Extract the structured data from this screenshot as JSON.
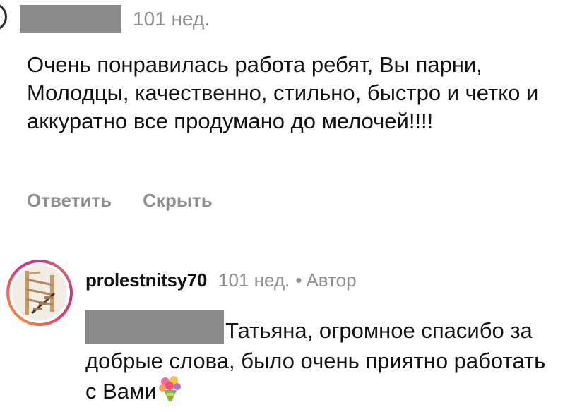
{
  "comment": {
    "time": "101 нед.",
    "text": "Очень понравилась работа ребят, Вы парни, Молодцы, качественно, стильно, быстро и четко и аккуратно все продумано до мелочей!!!!",
    "reply_label": "Ответить",
    "hide_label": "Скрыть"
  },
  "reply": {
    "username": "prolestnitsy70",
    "time": "101 нед.",
    "separator": "•",
    "author_badge": "Автор",
    "text": "Татьяна, огромное спасибо за добрые слова, было очень приятно работать с Вами",
    "emoji": "bouquet-emoji"
  },
  "colors": {
    "text": "#121212",
    "secondary": "#8e8e8e",
    "redaction": "#8a8a8a"
  }
}
